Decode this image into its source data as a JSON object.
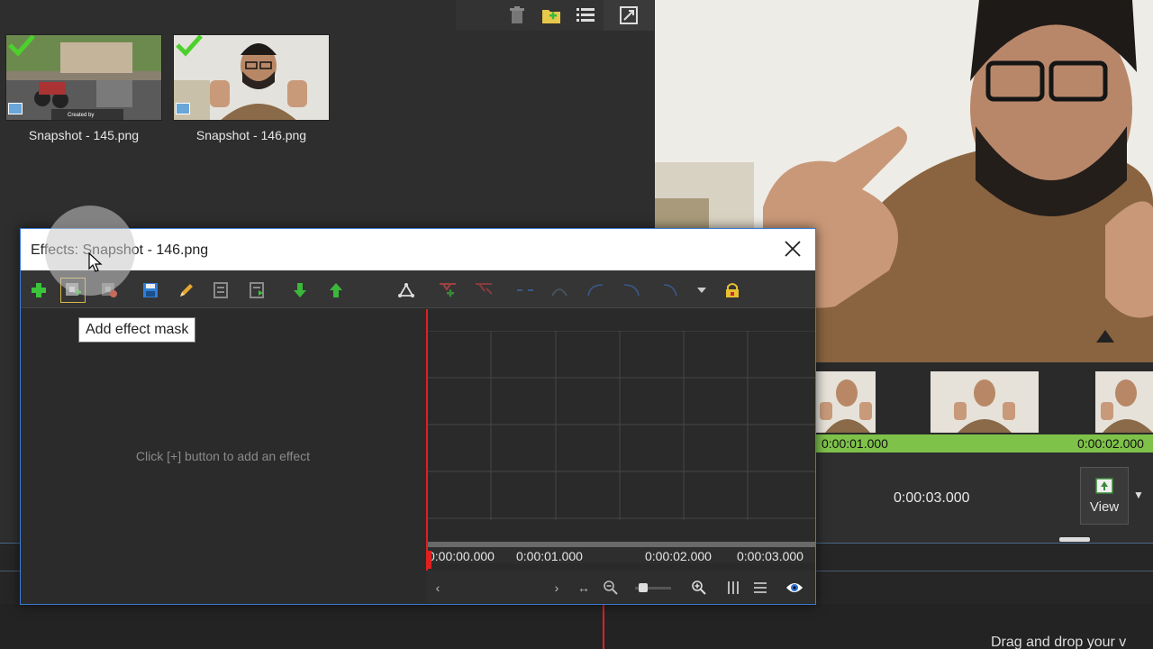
{
  "library": {
    "clips": [
      {
        "label": "Snapshot - 145.png",
        "watermark": "Created by"
      },
      {
        "label": "Snapshot - 146.png"
      }
    ],
    "toolbar_icons": [
      "trash-icon",
      "add-folder-icon",
      "list-view-icon",
      "dock-toggle-icon"
    ]
  },
  "timeline": {
    "ruler_labels": [
      "0:00:01.000",
      "0:00:02.000"
    ],
    "time_display": "0:00:03.000",
    "view_label": "View",
    "status_text": "Drag and drop your v"
  },
  "dialog": {
    "title": "Effects: Snapshot - 146.png",
    "tooltip": "Add effect mask",
    "empty_hint": "Click [+] button to add an effect",
    "kf_ticks": [
      "0:00:00.000",
      "0:00:01.000",
      "0:00:02.000",
      "0:00:03.000"
    ],
    "toolbar_icons": [
      "add-effect-icon",
      "add-effect-mask-icon",
      "remove-effect-mask-icon",
      "save-icon",
      "edit-icon",
      "import-icon",
      "export-icon",
      "move-down-icon",
      "move-up-icon",
      "keyframe-mode-icon",
      "add-keyframe-icon",
      "remove-keyframe-icon",
      "linear-curve-icon",
      "ease-in-icon",
      "ease-out-icon",
      "ease-in-out-icon",
      "curve-dropdown-icon",
      "lock-icon"
    ]
  },
  "colors": {
    "accent": "#3a7bd5",
    "ruler_green": "#7fc24a",
    "playhead_red": "#e02020",
    "check_green": "#4cd12c"
  }
}
